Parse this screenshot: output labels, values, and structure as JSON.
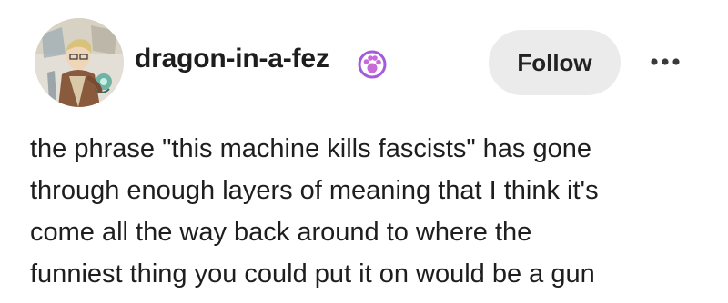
{
  "header": {
    "username": "dragon-in-a-fez",
    "badge_icon": "paw-badge-icon",
    "badge_color": "#a35bd9",
    "follow_label": "Follow",
    "more_icon": "more-dots-icon"
  },
  "post": {
    "lines": [
      "the phrase \"this machine kills fascists\" has gone",
      "through enough layers of meaning that I think it's",
      "come all the way back around to where the",
      "funniest thing you could put it on would be a gun"
    ]
  }
}
